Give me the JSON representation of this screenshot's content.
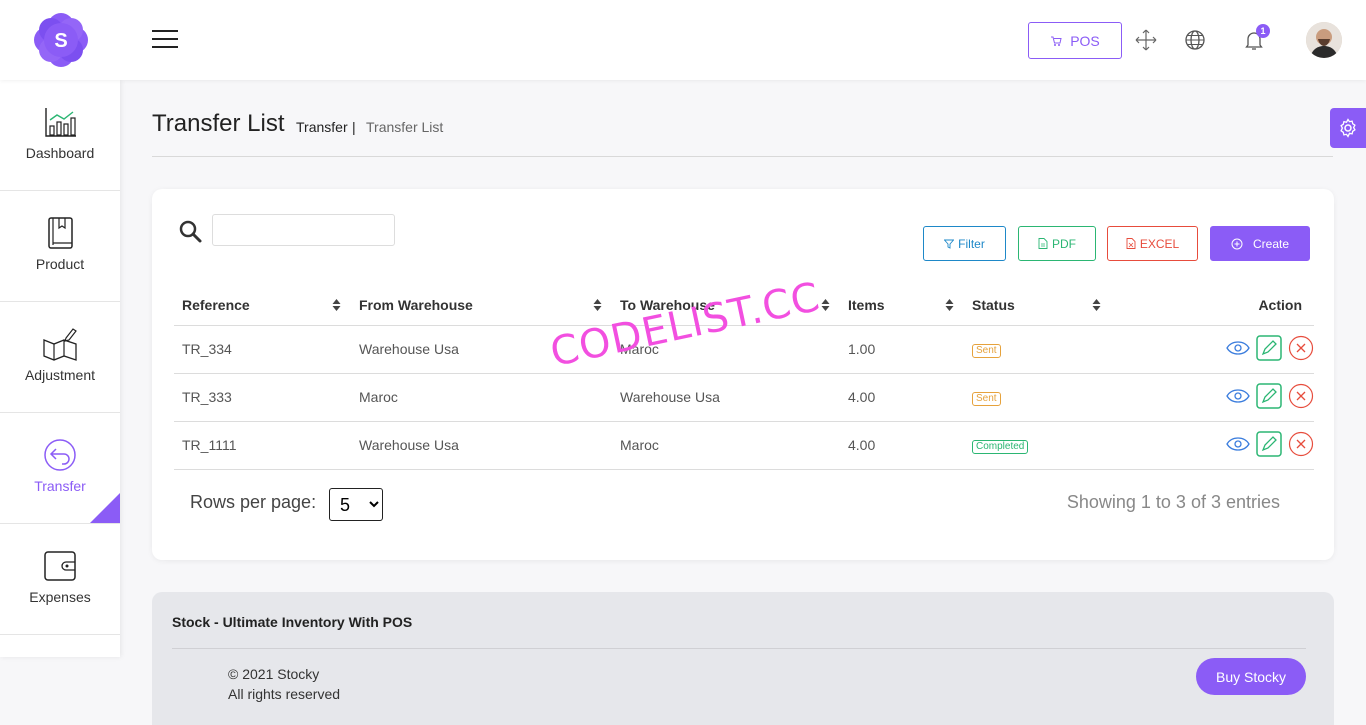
{
  "header": {
    "logo_letter": "S",
    "pos_label": "POS",
    "notification_count": "1"
  },
  "sidebar": {
    "items": [
      {
        "label": "Dashboard",
        "icon": "chart-icon"
      },
      {
        "label": "Product",
        "icon": "book-icon"
      },
      {
        "label": "Adjustment",
        "icon": "map-edit-icon"
      },
      {
        "label": "Transfer",
        "icon": "back-arrow-circle-icon",
        "active": true
      },
      {
        "label": "Expenses",
        "icon": "wallet-icon"
      }
    ]
  },
  "page": {
    "title": "Transfer List",
    "breadcrumb_parent": "Transfer",
    "breadcrumb_sep": "|",
    "breadcrumb_current": "Transfer List"
  },
  "toolbar": {
    "search_placeholder": "",
    "filter_label": "Filter",
    "pdf_label": "PDF",
    "excel_label": "EXCEL",
    "create_label": "Create"
  },
  "table": {
    "columns": [
      "Reference",
      "From Warehouse",
      "To Warehouse",
      "Items",
      "Status",
      "Action"
    ],
    "rows": [
      {
        "reference": "TR_334",
        "from": "Warehouse Usa",
        "to": "Maroc",
        "items": "1.00",
        "status": "Sent"
      },
      {
        "reference": "TR_333",
        "from": "Maroc",
        "to": "Warehouse Usa",
        "items": "4.00",
        "status": "Sent"
      },
      {
        "reference": "TR_1111",
        "from": "Warehouse Usa",
        "to": "Maroc",
        "items": "4.00",
        "status": "Completed"
      }
    ]
  },
  "pagination": {
    "rows_per_page_label": "Rows per page:",
    "rows_per_page_value": "5",
    "showing_text": "Showing 1 to 3 of 3 entries"
  },
  "watermark": "CODELIST.CC",
  "footer": {
    "title": "Stock - Ultimate Inventory With POS",
    "copyright": "© 2021 Stocky",
    "rights": "All rights reserved",
    "buy_label": "Buy Stocky"
  },
  "colors": {
    "accent": "#8b5cf6",
    "filter": "#1e88c8",
    "pdf": "#2bb673",
    "excel": "#e74c3c",
    "sent": "#e6a23c",
    "completed": "#2bb673"
  }
}
